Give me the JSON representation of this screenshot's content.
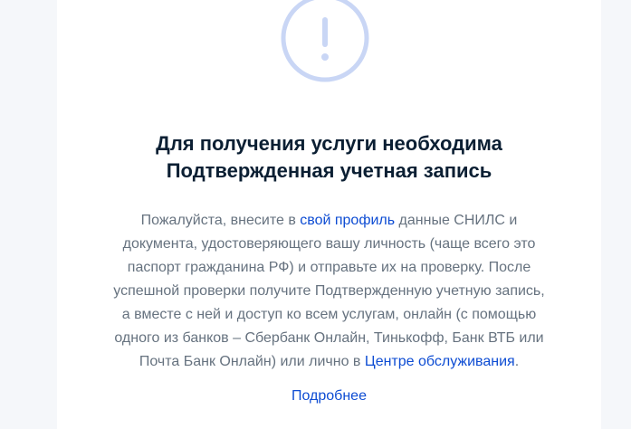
{
  "colors": {
    "accent_link": "#0d4cd3",
    "title": "#0b1f33",
    "body_text": "#66727f",
    "warning_circle": "#c9d6f5",
    "background": "#f5f7fa",
    "card": "#ffffff"
  },
  "icon": {
    "name": "exclamation-circle-icon"
  },
  "title": {
    "line1": "Для получения услуги необходима",
    "line2": "Подтвержденная учетная запись"
  },
  "body": {
    "l1_before": "Пожалуйста, внесите в ",
    "l1_link": "свой профиль",
    "l1_after": " данные СНИЛС и",
    "l2": "документа, удостоверяющего вашу личность (чаще всего это",
    "l3": "паспорт гражданина РФ) и отправьте их на проверку. После",
    "l4": "успешной проверки получите Подтвержденную учетную запись,",
    "l5": "а вместе с ней и доступ ко всем услугам, онлайн (с помощью",
    "l6": "одного из банков – Сбербанк Онлайн, Тинькофф, Банк ВТБ или",
    "l7_before": "Почта Банк Онлайн) или лично в ",
    "l7_link": "Центре обслуживания",
    "l7_after": "."
  },
  "more_link": "Подробнее"
}
